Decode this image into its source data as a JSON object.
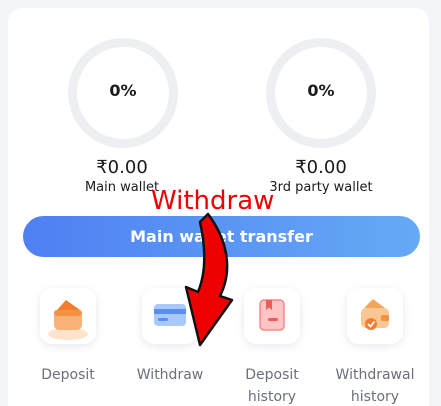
{
  "wallets": [
    {
      "percent": "0%",
      "amount": "₹0.00",
      "label": "Main wallet"
    },
    {
      "percent": "0%",
      "amount": "₹0.00",
      "label": "3rd party wallet"
    }
  ],
  "transfer_button": {
    "label": "Main wallet transfer"
  },
  "annotation": {
    "text": "Withdraw",
    "color": "#ee0000"
  },
  "actions": [
    {
      "label": "Deposit",
      "icon": "wallet-icon"
    },
    {
      "label": "Withdraw",
      "icon": "card-icon"
    },
    {
      "label": "Deposit history",
      "icon": "receipt-icon"
    },
    {
      "label": "Withdrawal history",
      "icon": "wallet-check-icon"
    }
  ],
  "colors": {
    "accent_start": "#4f80f2",
    "accent_end": "#65aaf5",
    "annotation": "#ee0000"
  }
}
